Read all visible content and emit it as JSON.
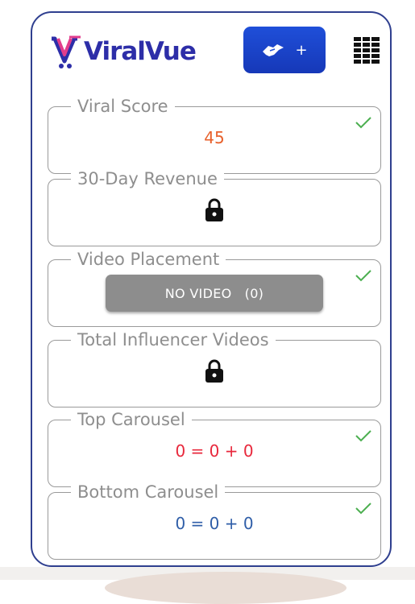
{
  "app": {
    "logo_text": "ViralVue",
    "logo_icon": "v-cart-logo-icon"
  },
  "header": {
    "share_button_plus": "+",
    "share_icon": "handshake-icon",
    "menu_icon": "grid-menu-icon"
  },
  "colors": {
    "brand": "#2d2ea8",
    "button": "#1f4fd9",
    "check": "#4caf50",
    "orange": "#e8612c",
    "red": "#e8283c",
    "blue": "#2f5ea8",
    "gray_button": "#8d8d8d"
  },
  "cards": [
    {
      "label": "Viral Score",
      "value": "45",
      "checked": true
    },
    {
      "label": "30-Day Revenue",
      "value": "",
      "locked": true
    },
    {
      "label": "Video Placement",
      "button_label": "NO VIDEO   (0)",
      "checked": true
    },
    {
      "label": "Total Influencer Videos",
      "value": "",
      "locked": true
    },
    {
      "label": "Top Carousel",
      "value": "0 = 0 + 0",
      "checked": true
    },
    {
      "label": "Bottom Carousel",
      "value": "0 = 0 + 0",
      "checked": true
    }
  ]
}
